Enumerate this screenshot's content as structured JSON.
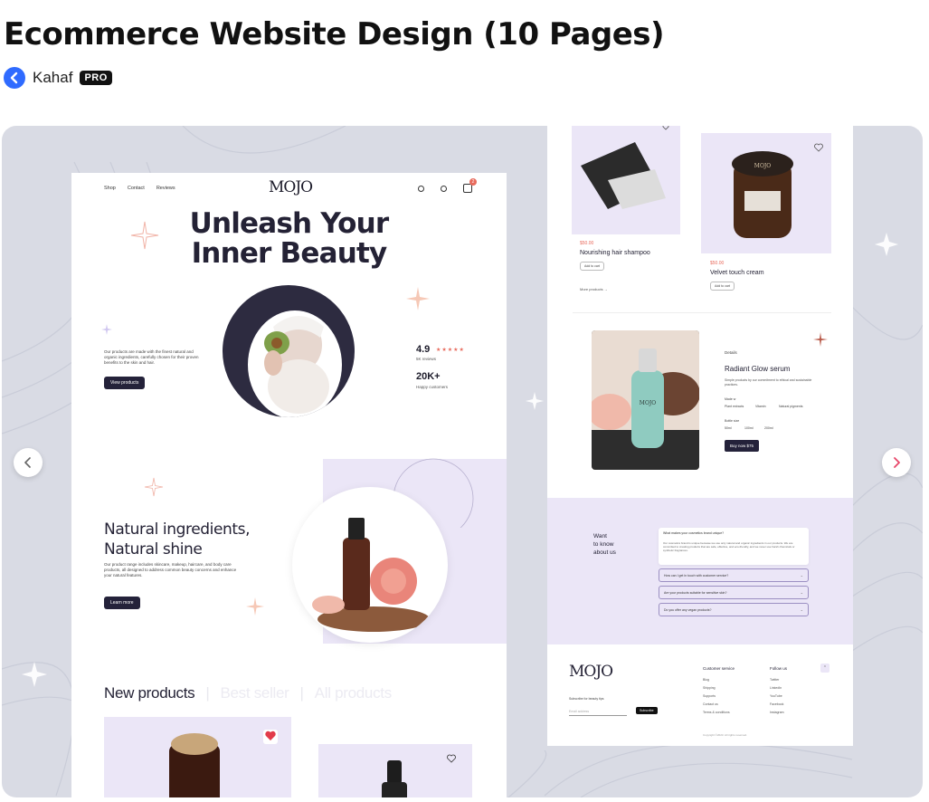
{
  "shot": {
    "title": "Ecommerce Website Design (10 Pages)",
    "author": "Kahaf",
    "badge": "PRO"
  },
  "carousel": {
    "prev_icon": "chevron-left-icon",
    "next_icon": "chevron-right-icon",
    "accent_color": "#e8476a"
  },
  "mock_home": {
    "nav": [
      "Shop",
      "Contact",
      "Reviews"
    ],
    "logo": "MOJO",
    "cart_count": "2",
    "hero_title_line1": "Unleash Your",
    "hero_title_line2": "Inner Beauty",
    "hero_desc": "Our products are made with the finest natural and organic ingredients, carefully chosen for their proven benefits to the skin and hair.",
    "hero_button": "View products",
    "rating": "4.9",
    "rating_stars": "★★★★★",
    "rating_sub": "5K reviews",
    "customers": "20K+",
    "customers_sub": "Happy customers",
    "section_title_line1": "Natural ingredients,",
    "section_title_line2": "Natural shine",
    "section_desc": "Our product range includes skincare, makeup, haircare, and body care products, all designed to address common beauty concerns and enhance your natural features.",
    "section_button": "Learn more",
    "tabs": [
      "New products",
      "Best seller",
      "All products"
    ],
    "tab_separator": "|"
  },
  "mock_product": {
    "product1_price": "$50.00",
    "product1_name": "Nourishing hair shampoo",
    "product2_price": "$50.00",
    "product2_name": "Velvet touch cream",
    "add_to_cart": "Add to cart",
    "more_products": "More products →",
    "details_label": "Details",
    "product_title": "Radiant Glow serum",
    "product_desc": "Simple products by our commitment to ethical and sustainable practices.",
    "made_with": "Made w",
    "made_with_options": [
      "Plant extracts",
      "Vitamin",
      "Natural pigments"
    ],
    "bottle_size": "Bottle size",
    "sizes": [
      "50ml",
      "100ml",
      "200ml"
    ],
    "buy_button": "Buy now $75",
    "faq_title_line1": "Want",
    "faq_title_line2": "to know",
    "faq_title_line3": "about us",
    "faq_open_q": "What makes your cosmetics brand unique?",
    "faq_open_a": "Our cosmetics brand is unique because we use only natural and organic ingredients in our products. We are committed to creating products that are safe, effective, and eco-friendly, and we never use harsh chemicals or synthetic fragrances.",
    "faq_items": [
      "How can I get in touch with customer service?",
      "Are your products suitable for sensitive skin?",
      "Do you offer any vegan products?"
    ],
    "footer_logo": "MOJO",
    "subscribe_label": "Subscribe for beauty tips",
    "email_placeholder": "Email address",
    "subscribe_button": "Subscribe",
    "col1_title": "Customer service",
    "col1_links": [
      "Blog",
      "Shipping",
      "Supports",
      "Contact us",
      "Terms & conditions"
    ],
    "col2_title": "Follow us",
    "col2_links": [
      "Twitter",
      "LinkedIn",
      "YouTube",
      "Facebook",
      "Instagram"
    ],
    "copyright": "Copyright ©2023. All rights reserved."
  }
}
